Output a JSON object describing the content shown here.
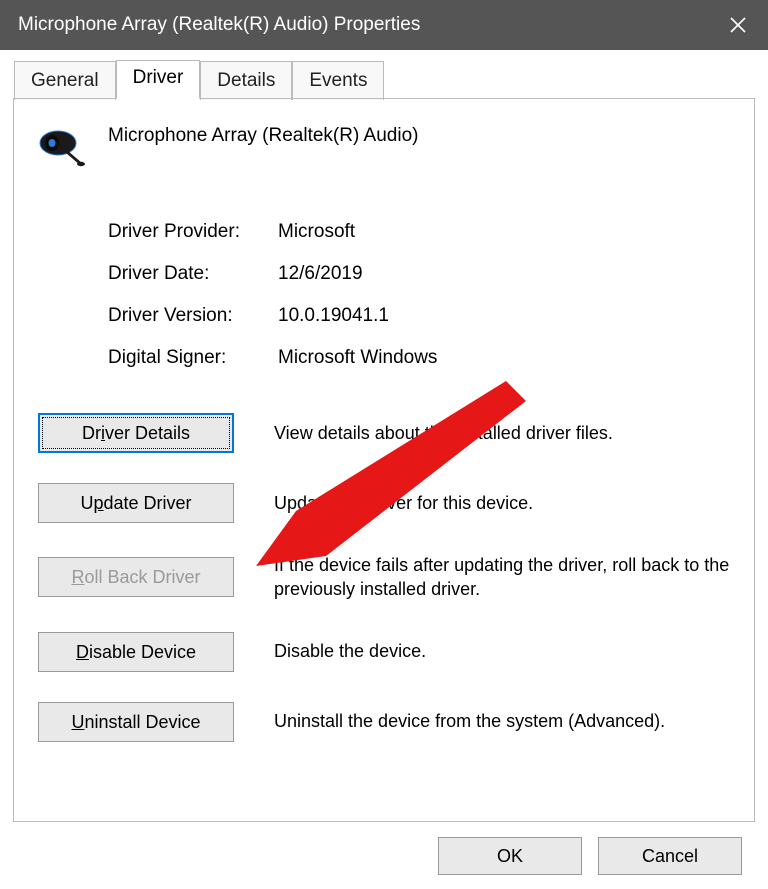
{
  "titlebar": {
    "title": "Microphone Array (Realtek(R) Audio) Properties"
  },
  "tabs": {
    "general": "General",
    "driver": "Driver",
    "details": "Details",
    "events": "Events"
  },
  "device": {
    "name": "Microphone Array (Realtek(R) Audio)"
  },
  "info": {
    "provider_label": "Driver Provider:",
    "provider_value": "Microsoft",
    "date_label": "Driver Date:",
    "date_value": "12/6/2019",
    "version_label": "Driver Version:",
    "version_value": "10.0.19041.1",
    "signer_label": "Digital Signer:",
    "signer_value": "Microsoft Windows"
  },
  "actions": {
    "details": {
      "label": "Driver Details",
      "desc": "View details about the installed driver files."
    },
    "update": {
      "label": "Update Driver",
      "desc": "Update the driver for this device."
    },
    "rollback": {
      "label": "Roll Back Driver",
      "desc": "If the device fails after updating the driver, roll back to the previously installed driver."
    },
    "disable": {
      "label": "Disable Device",
      "desc": "Disable the device."
    },
    "uninstall": {
      "label": "Uninstall Device",
      "desc": "Uninstall the device from the system (Advanced)."
    }
  },
  "footer": {
    "ok": "OK",
    "cancel": "Cancel"
  }
}
